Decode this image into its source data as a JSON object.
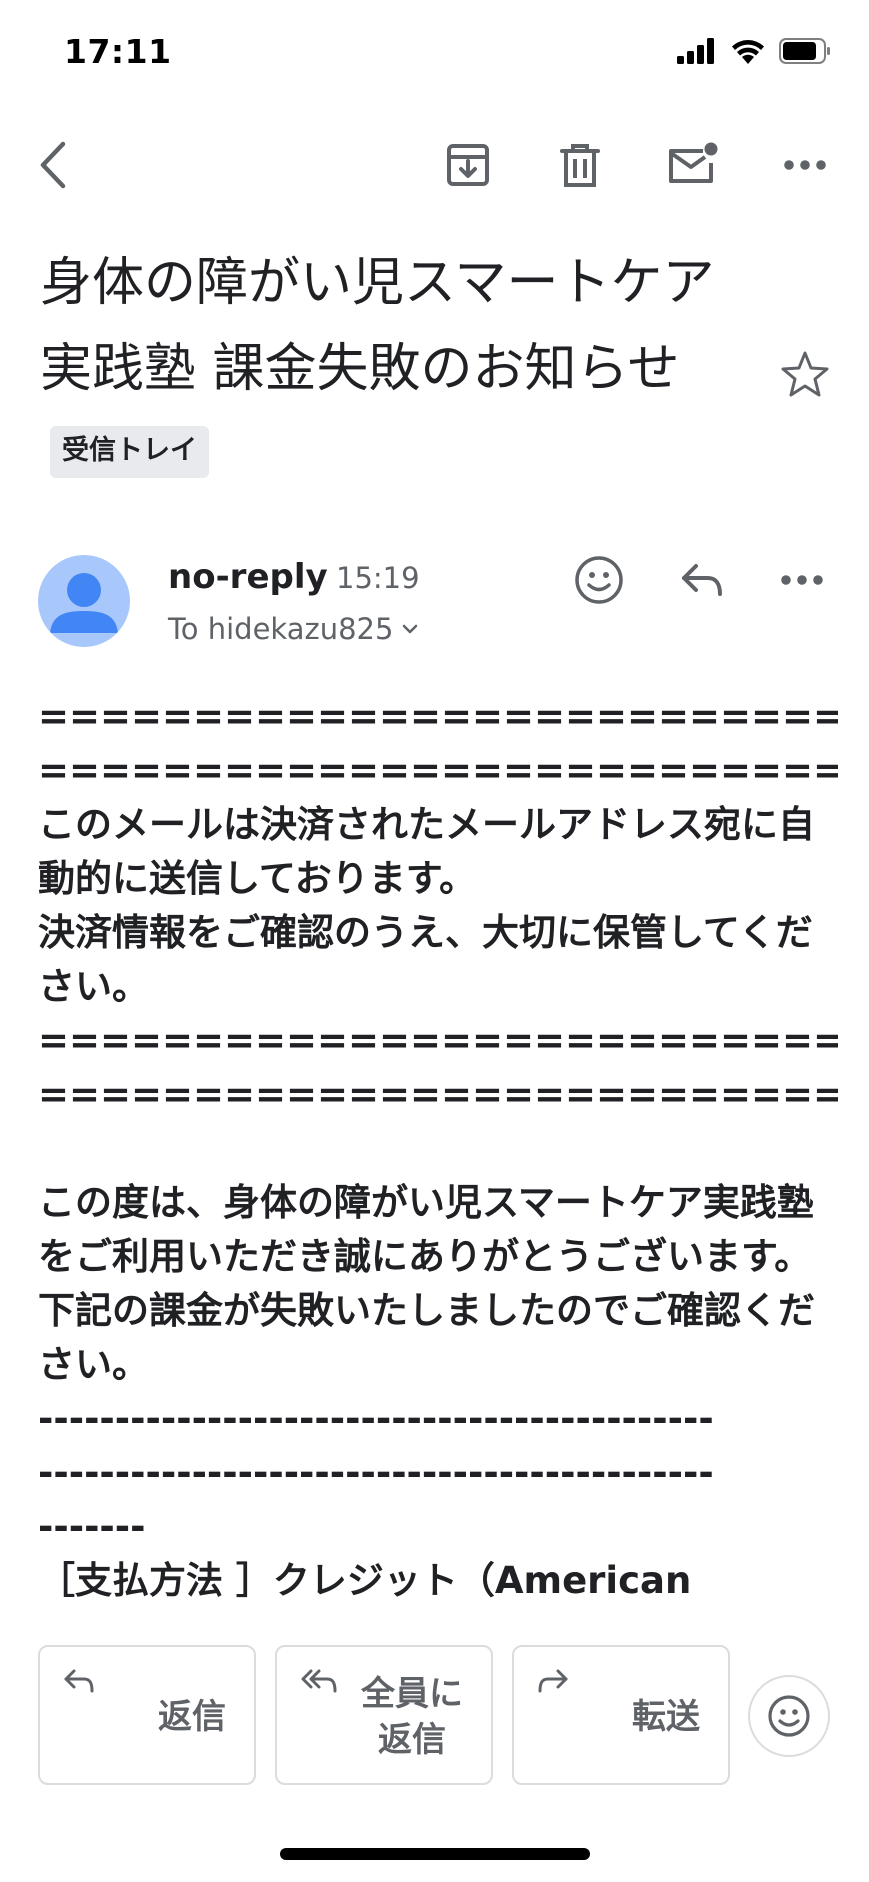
{
  "status_bar": {
    "time": "17:11"
  },
  "toolbar": {
    "back": "back-arrow-icon",
    "archive": "archive-icon",
    "delete": "trash-icon",
    "mark_unread": "mail-unread-icon",
    "more": "more-horizontal-icon"
  },
  "subject": {
    "text": "身体の障がい児スマートケア実践塾 課金失敗のお知らせ",
    "label": "受信トレイ"
  },
  "sender": {
    "name": "no-reply",
    "time": "15:19",
    "to": "To hidekazu825"
  },
  "body": {
    "sep_eq_1": "========================================",
    "sep_eq_2": "==============================",
    "notice_1": "このメールは決済されたメールアドレス宛に自動的に送信しております。",
    "notice_2": "決済情報をご確認のうえ、大切に保管してください。",
    "sep_eq_3": "========================================",
    "sep_eq_4": "==============================",
    "thanks": "この度は、身体の障がい児スマートケア実践塾をご利用いただき誠にありがとうございます。",
    "failure": "下記の課金が失敗いたしましたのでご確認ください。",
    "sep_dash_1": "--------------------------------------------",
    "sep_dash_2": "--------------------------------------------",
    "sep_dash_3": "-------",
    "payment": "［支払方法 ］クレジット（American"
  },
  "reply_bar": {
    "reply": "返信",
    "reply_all": "全員に\n返信",
    "forward": "転送"
  },
  "colors": {
    "avatar_bg": "#a8c7fa",
    "avatar_fg": "#4285f4",
    "text": "#202124",
    "muted": "#5f6368",
    "chip": "#e8eaed"
  }
}
